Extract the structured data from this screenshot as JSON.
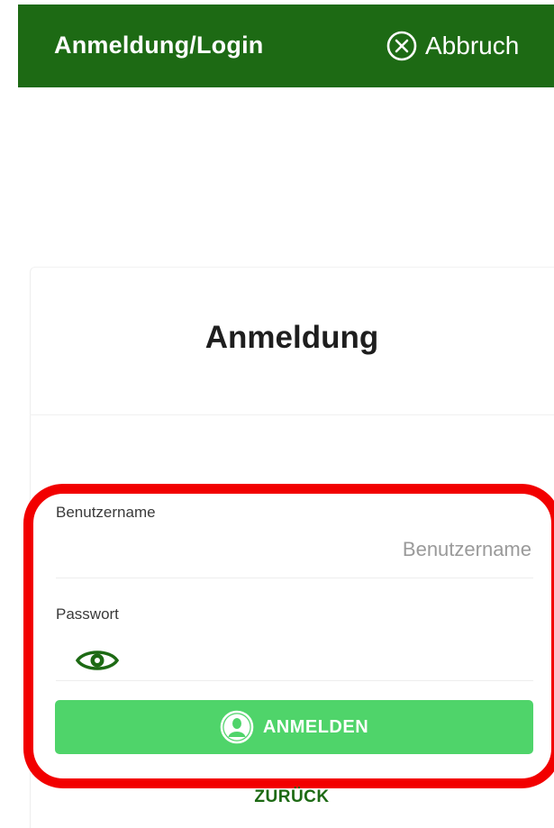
{
  "header": {
    "title": "Anmeldung/Login",
    "cancel_label": "Abbruch",
    "cancel_icon": "close-circle-icon",
    "background_color": "#1d6a14"
  },
  "form": {
    "heading": "Anmeldung",
    "username": {
      "label": "Benutzername",
      "placeholder": "Benutzername",
      "value": ""
    },
    "password": {
      "label": "Passwort",
      "value": "",
      "toggle_icon": "eye-icon"
    },
    "login_button": {
      "label": "ANMELDEN",
      "icon": "user-circle-icon",
      "color": "#4fd46a"
    },
    "back_label": "ZURÜCK"
  },
  "annotation": {
    "type": "highlight-box",
    "color": "#f20000"
  }
}
